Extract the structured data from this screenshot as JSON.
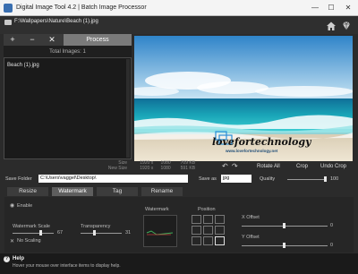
{
  "window": {
    "title": "Digital Image Tool 4.2  |  Batch Image Processor",
    "minimize": "—",
    "maximize": "☐",
    "close": "✕"
  },
  "pathbar": {
    "path": "F:\\Wallpapers\\Nature\\Beach (1).jpg"
  },
  "toolbar": {
    "add_label": "+",
    "remove_label": "−",
    "clear_label": "✕",
    "process_label": "Process"
  },
  "filelist": {
    "total_label": "Total Images:  1",
    "items": [
      "Beach (1).jpg"
    ]
  },
  "preview": {
    "watermark_text": "lovefortechnology",
    "watermark_url": "www.lovefortechnology.net"
  },
  "info": {
    "size_label": "Size",
    "new_size_label": "New Size",
    "size_w": "1920",
    "size_x": "x",
    "size_h": "1080",
    "size_kb": "709 KB",
    "new_w": "1920",
    "new_x": "x",
    "new_h": "1080",
    "new_kb": "591 KB"
  },
  "controls": {
    "rotate_left": "↶",
    "rotate_right": "↷",
    "rotate_all": "Rotate All",
    "crop": "Crop",
    "undo_crop": "Undo Crop"
  },
  "save": {
    "folder_label": "Save  Folder",
    "folder_value": "C:\\Users\\vaggel\\Desktop\\",
    "as_label": "Save  as",
    "format_value": "jpg",
    "quality_label": "Quality",
    "quality_value": "100"
  },
  "tabs": [
    "Resize",
    "Watermark",
    "Tag",
    "Rename"
  ],
  "watermark_panel": {
    "enable_label": "Enable",
    "scale_label": "Watermark  Scale",
    "scale_value": "67",
    "transparency_label": "Transparency",
    "transparency_value": "31",
    "no_scaling_label": "No  Scaling",
    "watermark_label": "Watermark",
    "position_label": "Position",
    "x_offset_label": "X  Offset",
    "x_offset_value": "0",
    "y_offset_label": "Y  Offset",
    "y_offset_value": "0"
  },
  "help": {
    "title": "Help",
    "message": "Hover your mouse over interface items to display help."
  },
  "colors": {
    "background": "#2b2b2b",
    "active_tab": "#5e5e5e",
    "process_button": "#7a7a7a"
  }
}
